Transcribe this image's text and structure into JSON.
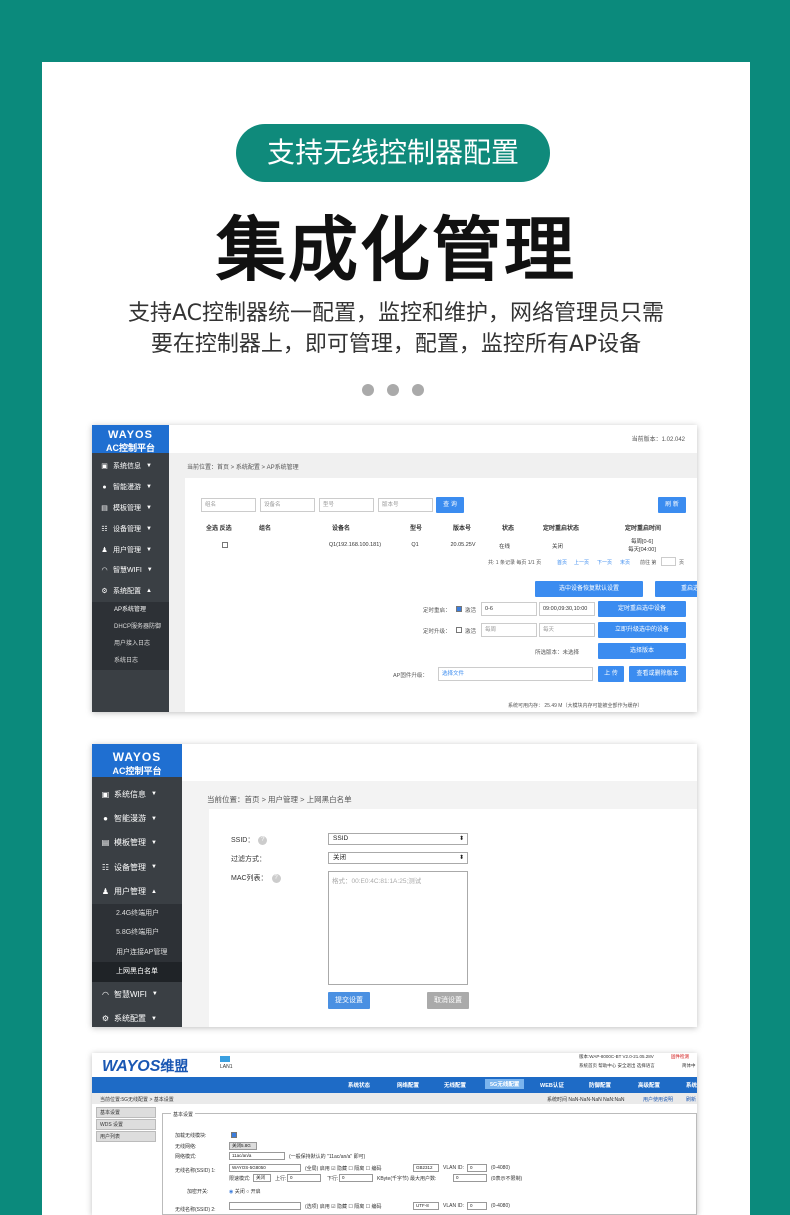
{
  "header": {
    "pill": "支持无线控制器配置",
    "title": "集成化管理",
    "desc_line1": "支持AC控制器统一配置，监控和维护，网络管理员只需",
    "desc_line2": "要在控制器上，即可管理，配置，监控所有AP设备"
  },
  "shot1": {
    "logo1": "WAYOS",
    "logo2": "AC控制平台",
    "version": "当前版本：1.02.042",
    "breadcrumb": "当前位置：首页 > 系统配置 > AP系统管理",
    "nav": [
      "系统信息",
      "智能漫游",
      "模板管理",
      "设备管理",
      "用户管理",
      "智慧WIFI",
      "系统配置"
    ],
    "sub": [
      "AP系统管理",
      "DHCP服务器防御",
      "用户接入日志",
      "系统日志"
    ],
    "filters": [
      "组名",
      "设备名",
      "型号",
      "版本号"
    ],
    "query": "查 询",
    "refresh": "刷 新",
    "cols": [
      "全选 反选",
      "组名",
      "设备名",
      "型号",
      "版本号",
      "状态",
      "定时重启状态",
      "定时重启时间"
    ],
    "row": {
      "device": "Q1(192.168.100.181)",
      "model": "Q1",
      "version": "20.05.25V",
      "status": "在线",
      "reboot_state": "关闭",
      "reboot_time1": "每周[0-6]",
      "reboot_time2": "每天[04:00]"
    },
    "pager": "共: 1 条记录 每页 1/1 页",
    "pager_links": [
      "首页",
      "上一页",
      "下一页",
      "末页"
    ],
    "pager_goto": "前往 第",
    "pager_page": "页",
    "btn_restore": "选中设备恢复默认设置",
    "btn_reboot": "重启选中的设备",
    "timed_reboot_label": "定时重启：",
    "timed_reboot_check": "激活",
    "timed_reboot_days": "0-6",
    "timed_reboot_times": "09:00,09:30,10:00",
    "btn_timed_reboot": "定时重启选中设备",
    "timed_upgrade_label": "定时升级：",
    "timed_upgrade_check": "激活",
    "timed_upgrade_weekly": "每周",
    "timed_upgrade_daily": "每天",
    "btn_upgrade_now": "立即升级选中的设备",
    "selected_version": "所选版本：未选择",
    "btn_choose_version": "选择版本",
    "firmware_label": "AP固件升级：",
    "firmware_placeholder": "选择文件",
    "btn_upload": "上 传",
    "btn_view_delete": "查看或删除版本",
    "memory": "系统可用内存：  25.49 M（大模块内存可能被全部作为缓存）"
  },
  "shot2": {
    "logo1": "WAYOS",
    "logo2": "AC控制平台",
    "breadcrumb": "当前位置：首页 > 用户管理 > 上网黑白名单",
    "nav": [
      "系统信息",
      "智能漫游",
      "模板管理",
      "设备管理",
      "用户管理",
      "智慧WIFI",
      "系统配置"
    ],
    "sub": [
      "2.4G终端用户",
      "5.8G终端用户",
      "用户连接AP管理",
      "上网黑白名单"
    ],
    "ssid_label": "SSID：",
    "ssid_value": "SSID",
    "filter_label": "过滤方式：",
    "filter_value": "关闭",
    "mac_label": "MAC列表：",
    "mac_placeholder": "格式：00:E0:4C:81:1A:25;测试",
    "submit": "提交设置",
    "cancel": "取消设置"
  },
  "shot3": {
    "logo": "WAYOS",
    "logo_cn": "维盟",
    "lan": "LAN1",
    "version": "版本:WAP-8000C-BT V2.0-21.05.28V",
    "upgrade_link": "固件检测",
    "top_links": "系统首页  帮助中心  安全退出  选择语言",
    "lang": "简体中",
    "menu": [
      "系统状态",
      "网络配置",
      "无线配置",
      "5G无线配置",
      "WEB认证",
      "防御配置",
      "高级配置",
      "系统"
    ],
    "breadcrumb": "当前位置:5G无线配置 > 基本设置",
    "systime": "系统时间 NaN-NaN-NaN NaN:NaN",
    "user_link": "用户使用说明",
    "refresh_link": "刷新",
    "leftnav": [
      "基本设置",
      "WDS 设置",
      "用户列表"
    ],
    "section": "基本设置",
    "load_module": "加载无线模块:",
    "wireless_net": "无线网络:",
    "wireless_net_btn": "关闭5.8G",
    "net_mode": "网络模式:",
    "net_mode_value": "11ac/an/a",
    "net_mode_hint": "(一般保持默认的 \"11ac/an/a\" 即可)",
    "ssid1_label": "无线名称(SSID) 1:",
    "ssid1_value": "WAYOS-5G8050",
    "ssid_opts": "(全局) 启用 ☑ 隐藏 ☐ 隔离 ☐ 编码",
    "ssid1_encode": "GB2312",
    "vlan_label": "VLAN ID:",
    "vlan_value": "0",
    "vlan_range": "(0-4080)",
    "limit_label": "限速模式:",
    "limit_value": "关闭",
    "up_label": "上行:",
    "up_value": "0",
    "down_label": "下行:",
    "down_value": "0",
    "kbyte": "KByte(千字节)  最大用户数:",
    "max_users": "0",
    "no_limit": "(0表示不限制)",
    "encrypt_label": "加密开关:",
    "encrypt_off": "关闭",
    "encrypt_on": "开启",
    "ssid2_label": "无线名称(SSID) 2:",
    "ssid2_opts": "(选项) 启用 ☑ 隐藏 ☐ 隔离 ☐ 编码",
    "ssid2_encode": "UTF-8"
  }
}
